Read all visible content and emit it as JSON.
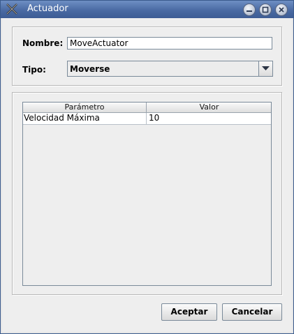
{
  "window": {
    "title": "Actuador",
    "icon": "crossed-tools-icon",
    "controls": [
      "minimize-icon",
      "maximize-icon",
      "close-icon"
    ]
  },
  "form": {
    "nombre_label": "Nombre:",
    "nombre_value": "MoveActuator",
    "tipo_label": "Tipo:",
    "tipo_value": "Moverse"
  },
  "table": {
    "columns": [
      "Parámetro",
      "Valor"
    ],
    "rows": [
      [
        "Velocidad Máxima",
        "10"
      ]
    ]
  },
  "buttons": {
    "accept": "Aceptar",
    "cancel": "Cancelar"
  },
  "colors": {
    "titlebar": "#4a6aa3",
    "background": "#eeeeee"
  }
}
